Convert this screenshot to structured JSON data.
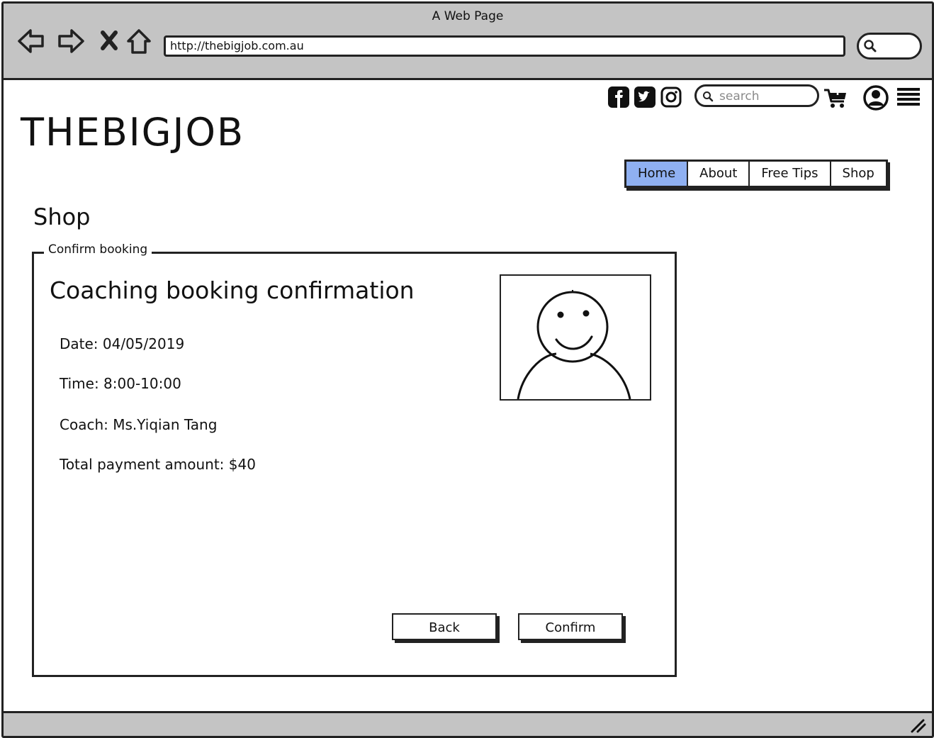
{
  "window": {
    "title": "A Web Page",
    "url": "http://thebigjob.com.au"
  },
  "site": {
    "logo": "THEBIGJOB",
    "search_placeholder": "search",
    "nav": [
      {
        "label": "Home",
        "active": true
      },
      {
        "label": "About",
        "active": false
      },
      {
        "label": "Free Tips",
        "active": false
      },
      {
        "label": "Shop",
        "active": false
      }
    ],
    "icons": [
      "facebook-icon",
      "twitter-icon",
      "instagram-icon",
      "search-icon",
      "cart-add-icon",
      "user-icon",
      "menu-icon"
    ],
    "active_tab_color": "#8fb0f1"
  },
  "page": {
    "heading": "Shop",
    "group_label": "Confirm booking",
    "title": "Coaching booking confirmation",
    "details": {
      "date": "Date: 04/05/2019",
      "time": "Time: 8:00-10:00",
      "coach": "Coach: Ms.Yiqian Tang",
      "total": "Total payment amount: $40"
    },
    "buttons": {
      "back": "Back",
      "confirm": "Confirm"
    }
  }
}
